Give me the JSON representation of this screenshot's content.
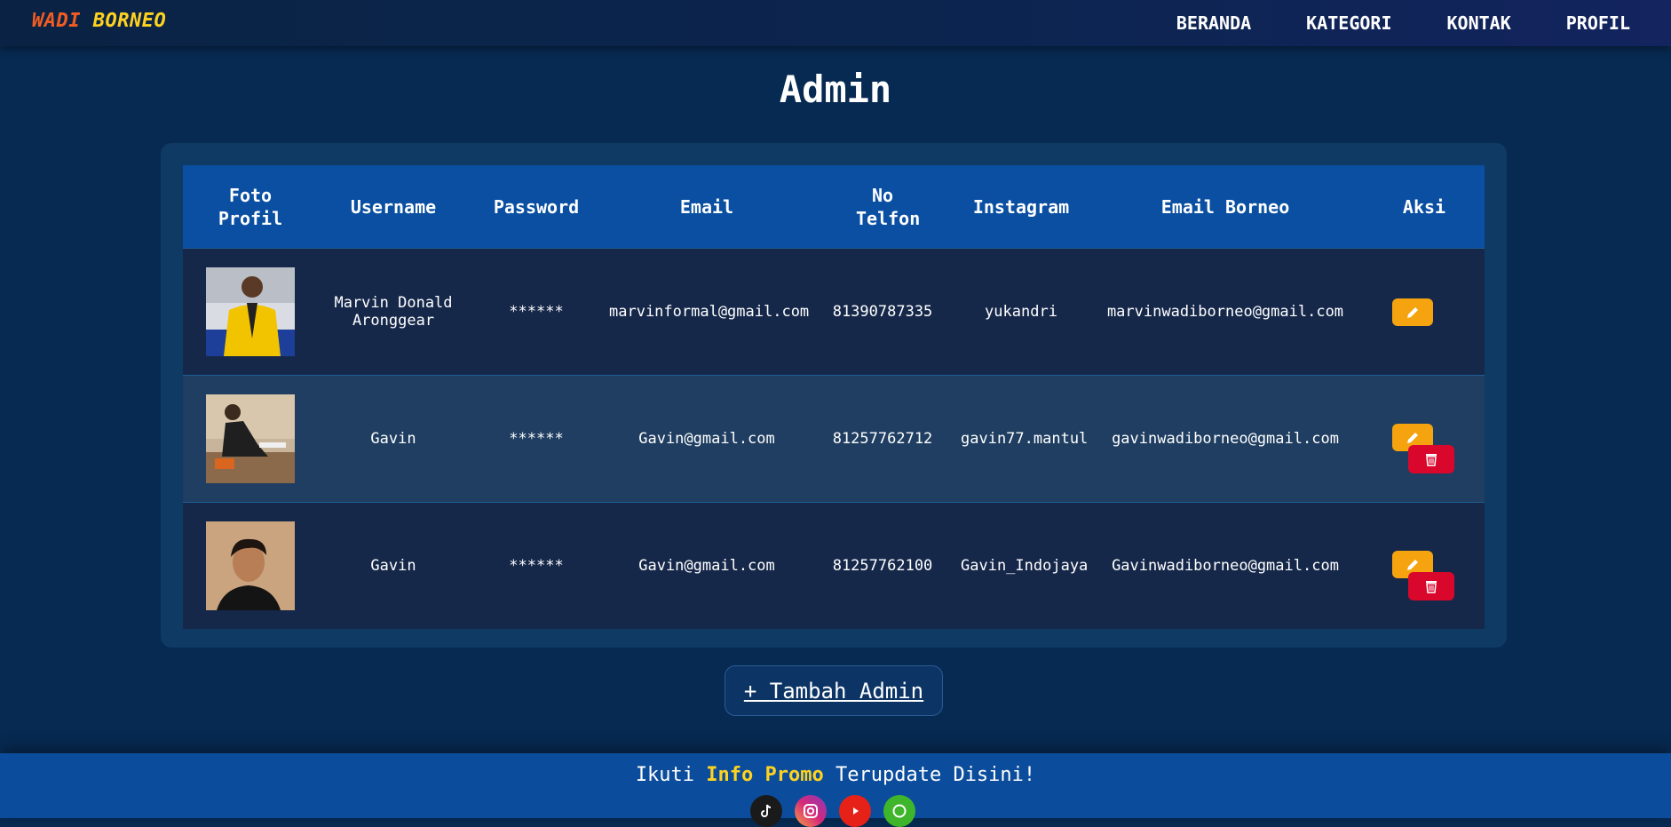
{
  "brand": {
    "word1": "WADI",
    "word2": "BORNEO"
  },
  "nav": {
    "items": [
      "BERANDA",
      "KATEGORI",
      "KONTAK",
      "PROFIL"
    ]
  },
  "page": {
    "title": "Admin"
  },
  "table": {
    "headers": [
      "Foto Profil",
      "Username",
      "Password",
      "Email",
      "No Telfon",
      "Instagram",
      "Email Borneo",
      "Aksi"
    ],
    "rows": [
      {
        "username": "Marvin Donald Aronggear",
        "password": "******",
        "email": "marvinformal@gmail.com",
        "phone": "81390787335",
        "instagram": "yukandri",
        "email_borneo": "marvinwadiborneo@gmail.com"
      },
      {
        "username": "Gavin",
        "password": "******",
        "email": "Gavin@gmail.com",
        "phone": "81257762712",
        "instagram": "gavin77.mantul",
        "email_borneo": "gavinwadiborneo@gmail.com"
      },
      {
        "username": "Gavin",
        "password": "******",
        "email": "Gavin@gmail.com",
        "phone": "81257762100",
        "instagram": "Gavin_Indojaya",
        "email_borneo": "Gavinwadiborneo@gmail.com"
      }
    ]
  },
  "add_button": {
    "label": "+ Tambah Admin"
  },
  "footer": {
    "text_before": "Ikuti ",
    "highlight": "Info Promo",
    "text_after": " Terupdate Disini!"
  },
  "colors": {
    "accent_edit": "#f5a30f",
    "accent_delete": "#d9072c",
    "header_bg": "#0a4fa1",
    "brand_orange": "#f25c22",
    "brand_yellow": "#ffd21f"
  },
  "icons": {
    "edit": "pencil-icon",
    "delete": "trash-icon",
    "socials": [
      "tiktok-icon",
      "instagram-icon",
      "youtube-icon",
      "whatsapp-icon"
    ]
  }
}
